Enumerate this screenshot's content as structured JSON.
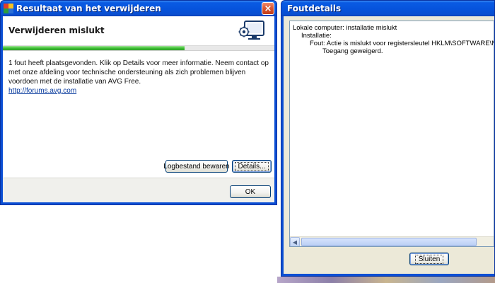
{
  "main_dialog": {
    "title": "Resultaat van het verwijderen",
    "close_label": "×",
    "header_title": "Verwijderen mislukt",
    "progress": 0.67,
    "message": "1 fout heeft plaatsgevonden. Klik op Details voor meer informatie. Neem contact op met onze afdeling voor technische ondersteuning als zich problemen blijven voordoen met de installatie van AVG Free.",
    "link": "http://forums.avg.com",
    "buttons": {
      "save_log": "Logbestand bewaren",
      "details": "Details...",
      "ok": "OK"
    }
  },
  "details_dialog": {
    "title": "Foutdetails",
    "lines": [
      "Lokale computer: installatie mislukt",
      "Installatie:",
      "Fout: Actie is mislukt voor registersleutel HKLM\\SOFTWARE\\Microsoft\\W",
      "Toegang geweigerd."
    ],
    "close_button": "Sluiten"
  },
  "colors": {
    "titlebar": "#0653dc",
    "progress": "#3fbf35",
    "link": "#0a3c9e"
  }
}
